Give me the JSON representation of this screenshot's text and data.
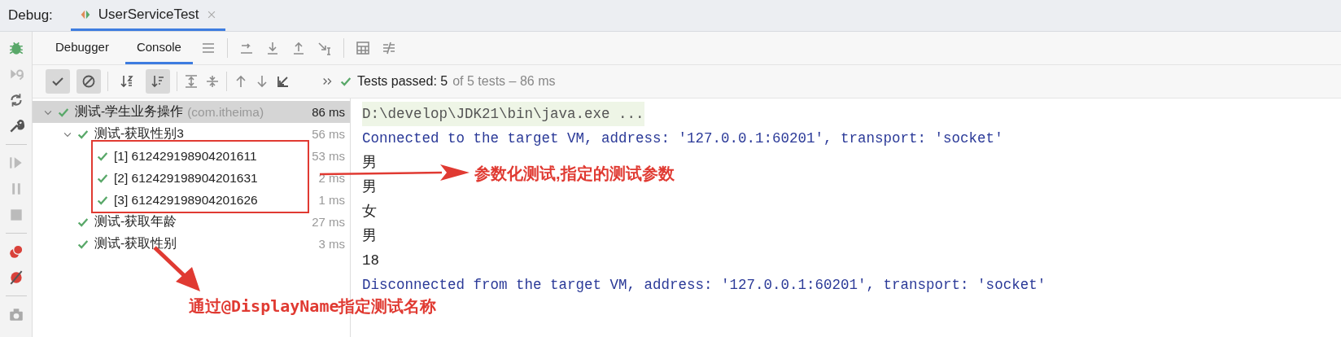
{
  "debug_label": "Debug:",
  "session_tab": {
    "label": "UserServiceTest",
    "selected": true
  },
  "view_tabs": [
    {
      "label": "Debugger",
      "selected": false
    },
    {
      "label": "Console",
      "selected": true
    }
  ],
  "test_filters": [
    {
      "on": true
    },
    {
      "on": true
    }
  ],
  "sort_toggles": [
    {
      "on": false
    },
    {
      "on": true
    }
  ],
  "status": {
    "summary": "Tests passed: 5",
    "detail": "of 5 tests – 86 ms"
  },
  "tests": [
    {
      "label": "测试-学生业务操作",
      "package": "(com.itheima)",
      "time": "86 ms",
      "selected": true,
      "expanded": true,
      "children": [
        {
          "label": "测试-获取性别3",
          "time": "56 ms",
          "selected": false,
          "expanded": true,
          "children": [
            {
              "label": "[1] 612429198904201611",
              "time": "53 ms",
              "selected": false
            },
            {
              "label": "[2] 612429198904201631",
              "time": "2 ms",
              "selected": false
            },
            {
              "label": "[3] 612429198904201626",
              "time": "1 ms",
              "selected": false
            }
          ]
        },
        {
          "label": "测试-获取年龄",
          "time": "27 ms",
          "selected": false
        },
        {
          "label": "测试-获取性别",
          "time": "3 ms",
          "selected": false
        }
      ]
    }
  ],
  "console": [
    {
      "kind": "command",
      "text": "D:\\develop\\JDK21\\bin\\java.exe ..."
    },
    {
      "kind": "system",
      "text": "Connected to the target VM, address: '127.0.0.1:60201', transport: 'socket'"
    },
    {
      "kind": "output",
      "text": "男"
    },
    {
      "kind": "output",
      "text": "男"
    },
    {
      "kind": "output",
      "text": "女"
    },
    {
      "kind": "output",
      "text": "男"
    },
    {
      "kind": "output",
      "text": "18"
    },
    {
      "kind": "system",
      "text": "Disconnected from the target VM, address: '127.0.0.1:60201', transport: 'socket'"
    }
  ],
  "annotations": [
    {
      "text": "参数化测试,指定的测试参数"
    },
    {
      "text": "通过@DisplayName指定测试名称"
    }
  ]
}
